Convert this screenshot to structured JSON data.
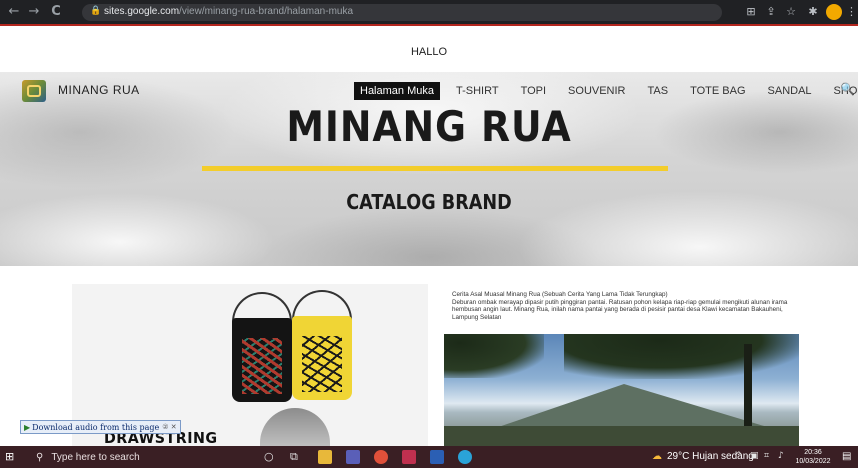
{
  "browser": {
    "back_icon": "←",
    "forward_icon": "→",
    "reload_icon": "C",
    "lock_icon": "🔒",
    "url_domain": "sites.google.com",
    "url_path": "/view/minang-rua-brand/halaman-muka"
  },
  "site": {
    "top_text": "HALLO",
    "brand_name": "MINANG RUA",
    "nav": [
      {
        "label": "Halaman Muka",
        "active": true
      },
      {
        "label": "T-SHIRT"
      },
      {
        "label": "TOPI"
      },
      {
        "label": "SOUVENIR"
      },
      {
        "label": "TAS"
      },
      {
        "label": "TOTE BAG"
      },
      {
        "label": "SANDAL"
      },
      {
        "label": "SHORT"
      }
    ],
    "hero_title": "MINANG RUA",
    "hero_subtitle": "CATALOG BRAND",
    "accent_color": "#f3cd2b"
  },
  "content": {
    "product_label": "DRAWSTRING",
    "story_head": "Cerita Asal Muasal Minang Rua (Sebuah Cerita Yang Lama Tidak Terungkap)",
    "story_body": "Deburan ombak merayap dipasir putih pinggiran pantai. Ratusan pohon kelapa riap-riap gemulai mengikuti alunan irama hembusan angin laut. Minang Rua, inilah nama pantai yang berada di pesisir pantai desa Klawi kecamatan Bakauheni, Lampung Selatan"
  },
  "audio_widget": {
    "label": "Download audio from this page",
    "extra": "② ✕"
  },
  "taskbar": {
    "search_placeholder": "Type here to search",
    "weather": "29°C  Hujan sedang",
    "time": "20:36",
    "date": "10/03/2022"
  }
}
